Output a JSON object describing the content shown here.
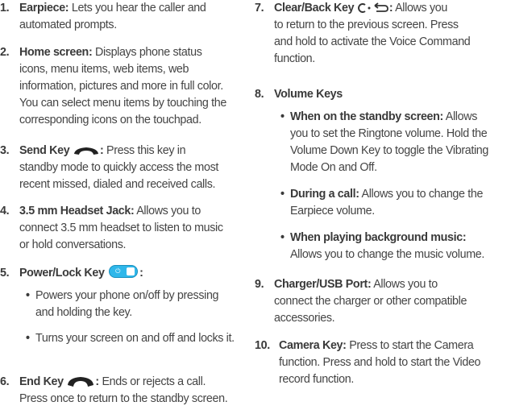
{
  "left": {
    "items": [
      {
        "num": "1.",
        "title": "Earpiece:",
        "lines": [
          "Lets you hear the caller and",
          "automated prompts."
        ]
      },
      {
        "num": "2.",
        "title": "Home screen:",
        "lines": [
          "Displays phone status",
          "icons, menu items, web items, web",
          "information, pictures and more in full color.",
          "You can select menu items by touching the",
          "corresponding icons on the touchpad."
        ]
      },
      {
        "num": "3.",
        "title": "Send Key",
        "lines": [
          "Press this key in",
          "standby mode to quickly access the most",
          "recent missed, dialed and received calls."
        ]
      },
      {
        "num": "4.",
        "title": "3.5 mm Headset Jack:",
        "lines": [
          "Allows you to",
          "connect 3.5 mm headset to listen to music",
          "or hold conversations."
        ]
      },
      {
        "num": "5.",
        "title": "Power/Lock Key",
        "bullets": [
          [
            "Powers your phone on/off by pressing",
            "and holding the key."
          ],
          [
            "Turns your screen on and off and locks it."
          ]
        ]
      },
      {
        "num": "6.",
        "title": "End Key",
        "lines": [
          "Ends or rejects a call.",
          "Press once to return to the standby screen."
        ]
      }
    ]
  },
  "right": {
    "items": [
      {
        "num": "7.",
        "title": "Clear/Back Key",
        "lines": [
          "Allows you",
          "to return to the previous screen. Press",
          "and hold to activate the Voice Command",
          "function."
        ]
      },
      {
        "num": "8.",
        "title": "Volume Keys",
        "bullets": [
          {
            "title": "When on the standby screen:",
            "lines": [
              "Allows",
              "you to set the Ringtone volume. Hold the",
              "Volume Down Key to toggle the Vibrating",
              "Mode On and Off."
            ]
          },
          {
            "title": "During a call:",
            "lines": [
              "Allows you to change the",
              "Earpiece volume."
            ]
          },
          {
            "title": "When playing background music:",
            "lines": [
              "Allows you to change the music volume."
            ]
          }
        ]
      },
      {
        "num": "9.",
        "title": "Charger/USB Port:",
        "lines": [
          "Allows you to",
          "connect the charger or other compatible",
          "accessories."
        ]
      },
      {
        "num": "10.",
        "title": "Camera Key:",
        "lines": [
          "Press to start the Camera",
          "function. Press and hold to start the Video",
          "record function."
        ]
      }
    ]
  },
  "icons": {
    "send": "phone-handset-icon",
    "power": "power-lock-icon",
    "end": "end-call-handset-icon",
    "clear": "clear-back-icon"
  },
  "colors": {
    "text": "#444444",
    "power_icon": "#2fb7ea"
  }
}
